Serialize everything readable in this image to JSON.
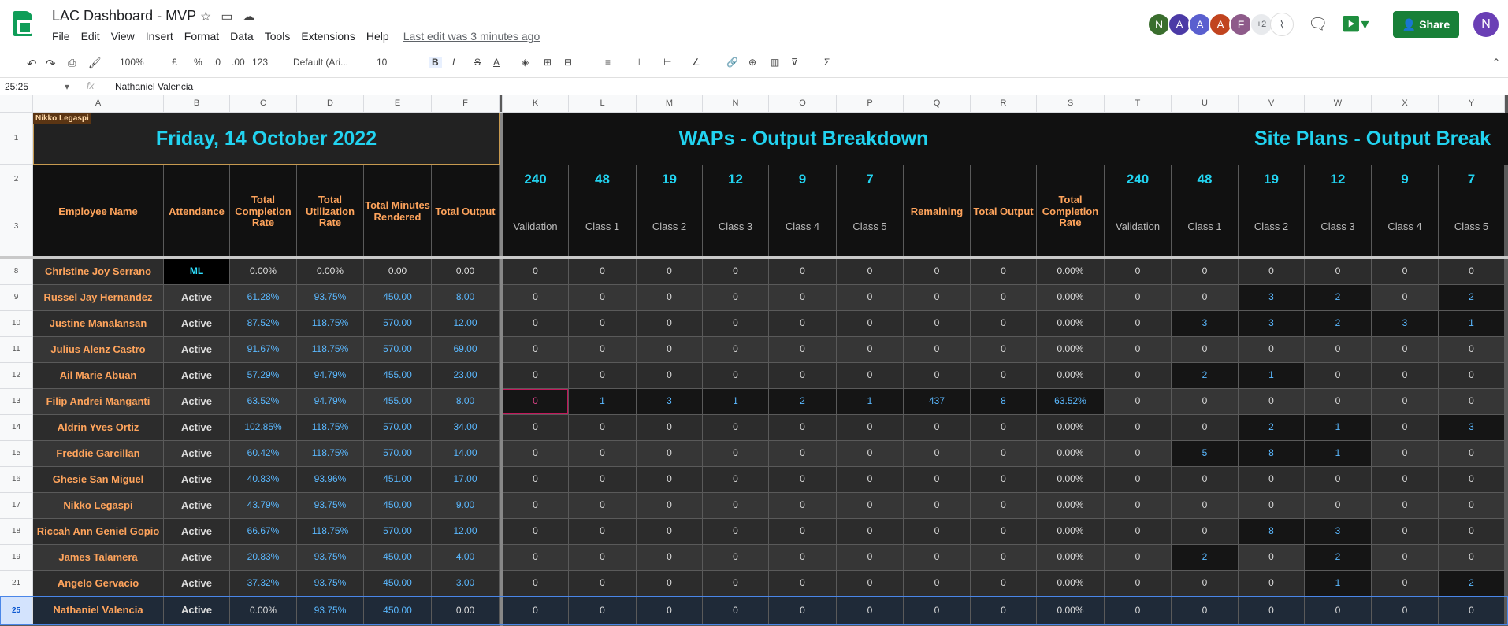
{
  "doc": {
    "title": "LAC Dashboard - MVP",
    "last_edit": "Last edit was 3 minutes ago"
  },
  "menu": [
    "File",
    "Edit",
    "View",
    "Insert",
    "Format",
    "Data",
    "Tools",
    "Extensions",
    "Help"
  ],
  "avatars": [
    {
      "letter": "N",
      "color": "#3a6e2e"
    },
    {
      "letter": "A",
      "color": "#4b3aa6"
    },
    {
      "letter": "A",
      "color": "#5a5fcf"
    },
    {
      "letter": "A",
      "color": "#c1441f"
    },
    {
      "letter": "F",
      "color": "#8e5b8a"
    },
    {
      "letter": "+2",
      "color": "#e8eaed"
    }
  ],
  "share_label": "Share",
  "me_letter": "N",
  "toolbar": {
    "zoom": "100%",
    "currency": "£",
    "percent": "%",
    "dec_minus": ".0",
    "dec_plus": ".00",
    "format": "123",
    "font": "Default (Ari...",
    "size": "10"
  },
  "formula": {
    "cell_ref": "25:25",
    "fx": "fx",
    "value": "Nathaniel Valencia"
  },
  "columns": [
    "A",
    "B",
    "C",
    "D",
    "E",
    "F",
    "K",
    "L",
    "M",
    "N",
    "O",
    "P",
    "Q",
    "R",
    "S",
    "T",
    "U",
    "V",
    "W",
    "X",
    "Y"
  ],
  "row_numbers": [
    "1",
    "2",
    "3",
    "8",
    "9",
    "10",
    "11",
    "12",
    "13",
    "14",
    "15",
    "16",
    "17",
    "18",
    "19",
    "21",
    "25"
  ],
  "tag": "Nikko Legaspi",
  "banner": {
    "date": "Friday, 14 October 2022",
    "waps": "WAPs - Output Breakdown",
    "site": "Site Plans - Output Break"
  },
  "left_headers": [
    "Employee Name",
    "Attendance",
    "Total Completion Rate",
    "Total Utilization Rate",
    "Total Minutes Rendered",
    "Total Output"
  ],
  "waps_top": [
    "240",
    "48",
    "19",
    "12",
    "9",
    "7"
  ],
  "waps_labels": [
    "Validation",
    "Class 1",
    "Class 2",
    "Class 3",
    "Class 4",
    "Class 5"
  ],
  "waps_extra": [
    "Remaining",
    "Total Output",
    "Total Completion Rate"
  ],
  "site_top": [
    "240",
    "48",
    "19",
    "12",
    "9",
    "7"
  ],
  "site_labels": [
    "Validation",
    "Class 1",
    "Class 2",
    "Class 3",
    "Class 4",
    "Class 5"
  ],
  "rows": [
    {
      "name": "Christine Joy Serrano",
      "att": "ML",
      "c": "0.00%",
      "u": "0.00%",
      "m": "0.00",
      "o": "0.00",
      "w": [
        "0",
        "0",
        "0",
        "0",
        "0",
        "0",
        "0",
        "0",
        "0.00%"
      ],
      "s": [
        "0",
        "0",
        "0",
        "0",
        "0",
        "0"
      ]
    },
    {
      "name": "Russel Jay Hernandez",
      "att": "Active",
      "c": "61.28%",
      "u": "93.75%",
      "m": "450.00",
      "o": "8.00",
      "w": [
        "0",
        "0",
        "0",
        "0",
        "0",
        "0",
        "0",
        "0",
        "0.00%"
      ],
      "s": [
        "0",
        "0",
        "3",
        "2",
        "0",
        "2"
      ]
    },
    {
      "name": "Justine Manalansan",
      "att": "Active",
      "c": "87.52%",
      "u": "118.75%",
      "m": "570.00",
      "o": "12.00",
      "w": [
        "0",
        "0",
        "0",
        "0",
        "0",
        "0",
        "0",
        "0",
        "0.00%"
      ],
      "s": [
        "0",
        "3",
        "3",
        "2",
        "3",
        "1"
      ]
    },
    {
      "name": "Julius Alenz Castro",
      "att": "Active",
      "c": "91.67%",
      "u": "118.75%",
      "m": "570.00",
      "o": "69.00",
      "w": [
        "0",
        "0",
        "0",
        "0",
        "0",
        "0",
        "0",
        "0",
        "0.00%"
      ],
      "s": [
        "0",
        "0",
        "0",
        "0",
        "0",
        "0"
      ]
    },
    {
      "name": "Ail Marie Abuan",
      "att": "Active",
      "c": "57.29%",
      "u": "94.79%",
      "m": "455.00",
      "o": "23.00",
      "w": [
        "0",
        "0",
        "0",
        "0",
        "0",
        "0",
        "0",
        "0",
        "0.00%"
      ],
      "s": [
        "0",
        "2",
        "1",
        "0",
        "0",
        "0"
      ]
    },
    {
      "name": "Filip Andrei Manganti",
      "att": "Active",
      "c": "63.52%",
      "u": "94.79%",
      "m": "455.00",
      "o": "8.00",
      "w": [
        "0",
        "1",
        "3",
        "1",
        "2",
        "1",
        "437",
        "8",
        "63.52%"
      ],
      "s": [
        "0",
        "0",
        "0",
        "0",
        "0",
        "0"
      ]
    },
    {
      "name": "Aldrin Yves Ortiz",
      "att": "Active",
      "c": "102.85%",
      "u": "118.75%",
      "m": "570.00",
      "o": "34.00",
      "w": [
        "0",
        "0",
        "0",
        "0",
        "0",
        "0",
        "0",
        "0",
        "0.00%"
      ],
      "s": [
        "0",
        "0",
        "2",
        "1",
        "0",
        "3"
      ]
    },
    {
      "name": "Freddie Garcillan",
      "att": "Active",
      "c": "60.42%",
      "u": "118.75%",
      "m": "570.00",
      "o": "14.00",
      "w": [
        "0",
        "0",
        "0",
        "0",
        "0",
        "0",
        "0",
        "0",
        "0.00%"
      ],
      "s": [
        "0",
        "5",
        "8",
        "1",
        "0",
        "0"
      ]
    },
    {
      "name": "Ghesie San Miguel",
      "att": "Active",
      "c": "40.83%",
      "u": "93.96%",
      "m": "451.00",
      "o": "17.00",
      "w": [
        "0",
        "0",
        "0",
        "0",
        "0",
        "0",
        "0",
        "0",
        "0.00%"
      ],
      "s": [
        "0",
        "0",
        "0",
        "0",
        "0",
        "0"
      ]
    },
    {
      "name": "Nikko Legaspi",
      "att": "Active",
      "c": "43.79%",
      "u": "93.75%",
      "m": "450.00",
      "o": "9.00",
      "w": [
        "0",
        "0",
        "0",
        "0",
        "0",
        "0",
        "0",
        "0",
        "0.00%"
      ],
      "s": [
        "0",
        "0",
        "0",
        "0",
        "0",
        "0"
      ]
    },
    {
      "name": "Riccah Ann Geniel Gopio",
      "att": "Active",
      "c": "66.67%",
      "u": "118.75%",
      "m": "570.00",
      "o": "12.00",
      "w": [
        "0",
        "0",
        "0",
        "0",
        "0",
        "0",
        "0",
        "0",
        "0.00%"
      ],
      "s": [
        "0",
        "0",
        "8",
        "3",
        "0",
        "0"
      ]
    },
    {
      "name": "James Talamera",
      "att": "Active",
      "c": "20.83%",
      "u": "93.75%",
      "m": "450.00",
      "o": "4.00",
      "w": [
        "0",
        "0",
        "0",
        "0",
        "0",
        "0",
        "0",
        "0",
        "0.00%"
      ],
      "s": [
        "0",
        "2",
        "0",
        "2",
        "0",
        "0"
      ]
    },
    {
      "name": "Angelo Gervacio",
      "att": "Active",
      "c": "37.32%",
      "u": "93.75%",
      "m": "450.00",
      "o": "3.00",
      "w": [
        "0",
        "0",
        "0",
        "0",
        "0",
        "0",
        "0",
        "0",
        "0.00%"
      ],
      "s": [
        "0",
        "0",
        "0",
        "1",
        "0",
        "2"
      ]
    },
    {
      "name": "Nathaniel Valencia",
      "att": "Active",
      "c": "0.00%",
      "u": "93.75%",
      "m": "450.00",
      "o": "0.00",
      "w": [
        "0",
        "0",
        "0",
        "0",
        "0",
        "0",
        "0",
        "0",
        "0.00%"
      ],
      "s": [
        "0",
        "0",
        "0",
        "0",
        "0",
        "0"
      ]
    }
  ]
}
